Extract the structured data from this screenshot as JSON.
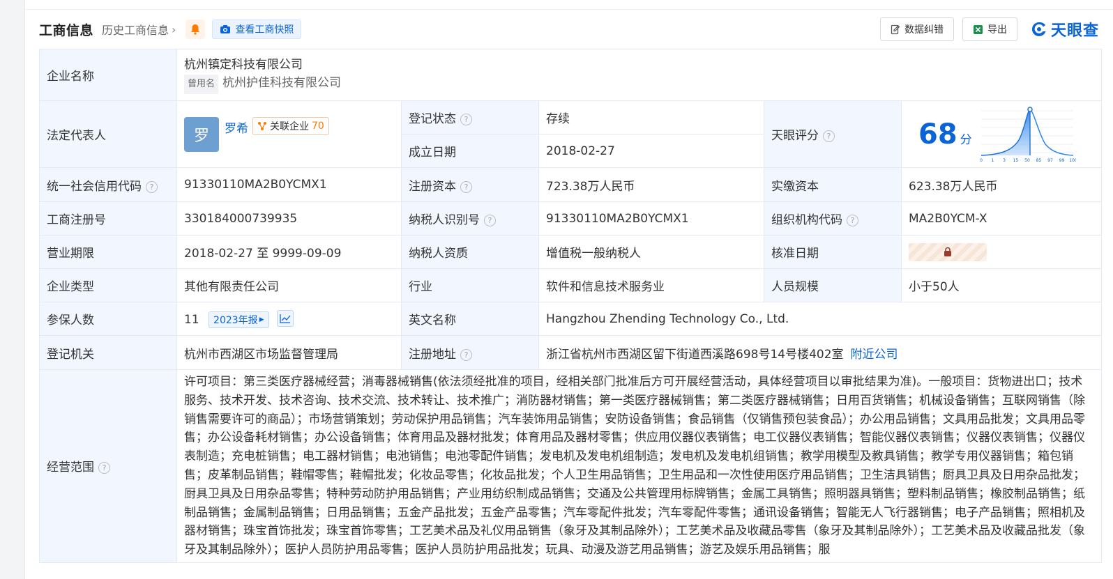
{
  "header": {
    "title": "工商信息",
    "history_link": "历史工商信息",
    "snapshot_button": "查看工商快照",
    "correct_button": "数据纠错",
    "export_button": "导出",
    "logo_text": "天眼查"
  },
  "company": {
    "label": "企业名称",
    "name": "杭州镇定科技有限公司",
    "used_name_tag": "曾用名",
    "used_name": "杭州护佳科技有限公司"
  },
  "legal_rep": {
    "label": "法定代表人",
    "avatar_char": "罗",
    "name": "罗希",
    "related_label": "关联企业",
    "related_count": "70"
  },
  "reg_status": {
    "label": "登记状态",
    "value": "存续"
  },
  "est_date": {
    "label": "成立日期",
    "value": "2018-02-27"
  },
  "score": {
    "label": "天眼评分",
    "value": "68",
    "unit": "分",
    "ticks": [
      "0",
      "1",
      "3",
      "15",
      "50",
      "85",
      "97",
      "99",
      "100"
    ]
  },
  "credit_code": {
    "label": "统一社会信用代码",
    "value": "91330110MA2B0YCMX1"
  },
  "reg_capital": {
    "label": "注册资本",
    "value": "723.38万人民币"
  },
  "paid_capital": {
    "label": "实缴资本",
    "value": "623.38万人民币"
  },
  "biz_reg_no": {
    "label": "工商注册号",
    "value": "330184000739935"
  },
  "taxpayer_id": {
    "label": "纳税人识别号",
    "value": "91330110MA2B0YCMX1"
  },
  "org_code": {
    "label": "组织机构代码",
    "value": "MA2B0YCM-X"
  },
  "biz_term": {
    "label": "营业期限",
    "value": "2018-02-27 至 9999-09-09"
  },
  "taxpayer_quali": {
    "label": "纳税人资质",
    "value": "增值税一般纳税人"
  },
  "approve_date": {
    "label": "核准日期"
  },
  "company_type": {
    "label": "企业类型",
    "value": "其他有限责任公司"
  },
  "industry": {
    "label": "行业",
    "value": "软件和信息技术服务业"
  },
  "staff_size": {
    "label": "人员规模",
    "value": "小于50人"
  },
  "insured": {
    "label": "参保人数",
    "value": "11",
    "year_tag": "2023年报"
  },
  "english_name": {
    "label": "英文名称",
    "value": "Hangzhou Zhending Technology Co., Ltd."
  },
  "reg_authority": {
    "label": "登记机关",
    "value": "杭州市西湖区市场监督管理局"
  },
  "reg_address": {
    "label": "注册地址",
    "value": "浙江省杭州市西湖区留下街道西溪路698号14号楼402室",
    "nearby_link": "附近公司"
  },
  "biz_scope": {
    "label": "经营范围",
    "value": "许可项目：第三类医疗器械经营；消毒器械销售(依法须经批准的项目，经相关部门批准后方可开展经营活动，具体经营项目以审批结果为准)。一般项目：货物进出口；技术服务、技术开发、技术咨询、技术交流、技术转让、技术推广；消防器材销售；第一类医疗器械销售；第二类医疗器械销售；日用百货销售；机械设备销售；互联网销售（除销售需要许可的商品）；市场营销策划；劳动保护用品销售；汽车装饰用品销售；安防设备销售；食品销售（仅销售预包装食品）；办公用品销售；文具用品批发；文具用品零售；办公设备耗材销售；办公设备销售；体育用品及器材批发；体育用品及器材零售；供应用仪器仪表销售；电工仪器仪表销售；智能仪器仪表销售；仪器仪表销售；仪器仪表制造；充电桩销售；电工器材销售；电池销售；电池零配件销售；发电机及发电机组制造；发电机及发电机组销售；教学用模型及教具销售；教学专用仪器销售；箱包销售；皮革制品销售；鞋帽零售；鞋帽批发；化妆品零售；化妆品批发；个人卫生用品销售；卫生用品和一次性使用医疗用品销售；卫生洁具销售；厨具卫具及日用杂品批发；厨具卫具及日用杂品零售；特种劳动防护用品销售；产业用纺织制成品销售；交通及公共管理用标牌销售；金属工具销售；照明器具销售；塑料制品销售；橡胶制品销售；纸制品销售；金属制品销售；日用品销售；五金产品批发；五金产品零售；汽车零配件批发；汽车零配件零售；通讯设备销售；智能无人飞行器销售；电子产品销售；照相机及器材销售；珠宝首饰批发；珠宝首饰零售；工艺美术品及礼仪用品销售（象牙及其制品除外）；工艺美术品及收藏品零售（象牙及其制品除外）；工艺美术品及收藏品批发（象牙及其制品除外）；医护人员防护用品零售；医护人员防护用品批发；玩具、动漫及游艺用品销售；游艺及娱乐用品销售；服"
  },
  "colors": {
    "accent": "#0a64d6",
    "label_bg": "#f2f7ff",
    "status_green": "#17a34a",
    "orange": "#ff7a00"
  }
}
